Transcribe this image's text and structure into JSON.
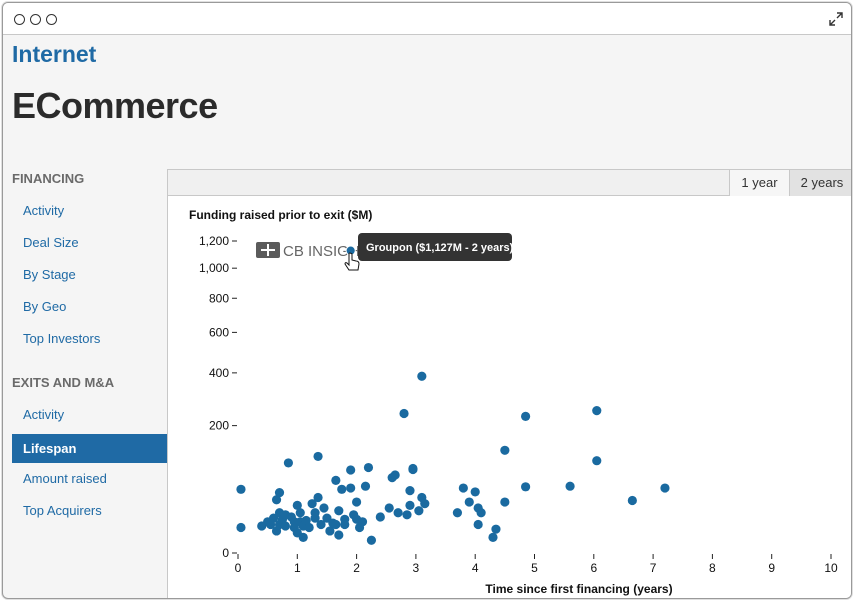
{
  "header": {
    "category": "Internet",
    "title": "ECommerce"
  },
  "sidebar": {
    "financing_heading": "FINANCING",
    "financing_items": [
      "Activity",
      "Deal Size",
      "By Stage",
      "By Geo",
      "Top Investors"
    ],
    "exits_heading": "EXITS AND M&A",
    "exits_items": [
      "Activity",
      "Lifespan",
      "Amount raised",
      "Top Acquirers"
    ],
    "active_item": "Lifespan"
  },
  "range_buttons": {
    "one_year": "1 year",
    "two_years": "2 years",
    "selected": "2 years"
  },
  "tooltip": "Groupon ($1,127M - 2 years)",
  "watermark": "CB INSIGHTS",
  "colors": {
    "accent": "#1f6aa5",
    "point": "#1a6aa0",
    "tooltip_bg": "#333333"
  },
  "chart_data": {
    "type": "scatter",
    "title": "Funding raised prior to exit ($M)",
    "xlabel": "Time since first financing (years)",
    "ylabel": "",
    "xlim": [
      0,
      10
    ],
    "ylim": [
      0,
      1200
    ],
    "xticks": [
      0,
      1,
      2,
      3,
      4,
      5,
      6,
      7,
      8,
      9,
      10
    ],
    "yticks": [
      0,
      200,
      400,
      600,
      800,
      1000,
      1200
    ],
    "ytick_labels": [
      "0",
      "200",
      "400",
      "600",
      "800",
      "1,000",
      "1,200"
    ],
    "yscale": "sqrt",
    "grid": false,
    "highlighted": {
      "label": "Groupon",
      "x": 1.9,
      "y": 1127
    },
    "points": [
      [
        0.05,
        50
      ],
      [
        0.05,
        8
      ],
      [
        0.4,
        9
      ],
      [
        0.5,
        12
      ],
      [
        0.55,
        10
      ],
      [
        0.6,
        15
      ],
      [
        0.65,
        6
      ],
      [
        0.7,
        20
      ],
      [
        0.65,
        35
      ],
      [
        0.7,
        10
      ],
      [
        0.75,
        14
      ],
      [
        0.7,
        45
      ],
      [
        0.8,
        18
      ],
      [
        0.8,
        9
      ],
      [
        0.85,
        100
      ],
      [
        0.9,
        16
      ],
      [
        0.95,
        8
      ],
      [
        0.95,
        12
      ],
      [
        1.0,
        5
      ],
      [
        1.05,
        12
      ],
      [
        1.0,
        28
      ],
      [
        1.05,
        20
      ],
      [
        1.1,
        9
      ],
      [
        1.1,
        3
      ],
      [
        1.15,
        13
      ],
      [
        1.2,
        8
      ],
      [
        1.25,
        30
      ],
      [
        1.3,
        20
      ],
      [
        1.3,
        15
      ],
      [
        1.35,
        38
      ],
      [
        1.35,
        115
      ],
      [
        1.4,
        10
      ],
      [
        1.45,
        25
      ],
      [
        1.5,
        15
      ],
      [
        1.55,
        6
      ],
      [
        1.6,
        11
      ],
      [
        1.65,
        10
      ],
      [
        1.65,
        65
      ],
      [
        1.7,
        22
      ],
      [
        1.7,
        4
      ],
      [
        1.75,
        50
      ],
      [
        1.8,
        14
      ],
      [
        1.8,
        10
      ],
      [
        1.9,
        85
      ],
      [
        1.9,
        52
      ],
      [
        1.95,
        18
      ],
      [
        2.0,
        14
      ],
      [
        2.0,
        32
      ],
      [
        2.05,
        8
      ],
      [
        2.1,
        12
      ],
      [
        2.15,
        55
      ],
      [
        2.2,
        90
      ],
      [
        2.25,
        2
      ],
      [
        2.4,
        16
      ],
      [
        2.55,
        25
      ],
      [
        2.6,
        70
      ],
      [
        2.65,
        75
      ],
      [
        2.7,
        20
      ],
      [
        2.8,
        240
      ],
      [
        2.85,
        18
      ],
      [
        2.9,
        28
      ],
      [
        2.9,
        48
      ],
      [
        2.95,
        88
      ],
      [
        2.95,
        86
      ],
      [
        3.05,
        22
      ],
      [
        3.1,
        385
      ],
      [
        3.1,
        38
      ],
      [
        3.15,
        30
      ],
      [
        3.7,
        20
      ],
      [
        3.8,
        52
      ],
      [
        3.9,
        32
      ],
      [
        4.0,
        46
      ],
      [
        4.05,
        25
      ],
      [
        4.05,
        10
      ],
      [
        4.1,
        20
      ],
      [
        4.3,
        3
      ],
      [
        4.35,
        7
      ],
      [
        4.5,
        130
      ],
      [
        4.5,
        32
      ],
      [
        4.85,
        230
      ],
      [
        4.85,
        54
      ],
      [
        5.6,
        55
      ],
      [
        6.05,
        250
      ],
      [
        6.05,
        105
      ],
      [
        6.65,
        34
      ],
      [
        7.2,
        52
      ]
    ]
  }
}
